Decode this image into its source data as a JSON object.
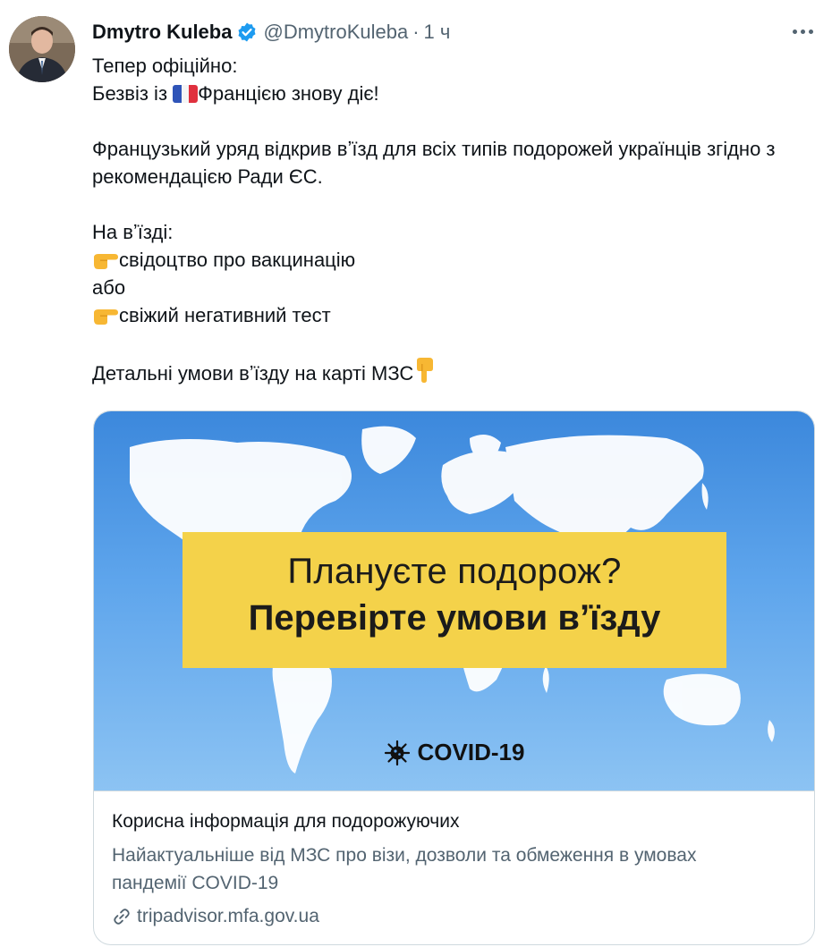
{
  "author": {
    "name": "Dmytro Kuleba",
    "handle": "@DmytroKuleba",
    "separator": "·",
    "time": "1 ч"
  },
  "tweet": {
    "line1": "Тепер офіційно:",
    "line2_before": "Безвіз із ",
    "line2_after": "Францією знову діє!",
    "line3": "Французький уряд відкрив вʼїзд для всіх типів подорожей українців згідно з рекомендацією Ради ЄС.",
    "line4": "На вʼїзді:",
    "line5": "свідоцтво про вакцинацію",
    "line6": "або",
    "line7": "свіжий негативний тест",
    "line8": "Детальні умови вʼїзду на карті МЗС"
  },
  "card": {
    "banner_line1": "Плануєте подорож?",
    "banner_line2": "Перевірте умови вʼїзду",
    "covid_label": "COVID-19",
    "title": "Корисна інформація для подорожуючих",
    "description": "Найактуальніше від МЗС про візи, дозволи та обмеження в умовах пандемії COVID-19",
    "url": "tripadvisor.mfa.gov.ua"
  },
  "icons": {
    "verified": "verified-badge-icon",
    "more": "more-options-icon",
    "flag": "france-flag-icon",
    "pointing_right": "pointing-right-icon",
    "pointing_down": "pointing-down-icon",
    "virus": "virus-icon",
    "link": "link-icon"
  },
  "colors": {
    "verified": "#1d9bf0",
    "secondary_text": "#536471",
    "banner": "#f4d24a",
    "sky": "#5ea5ec"
  }
}
